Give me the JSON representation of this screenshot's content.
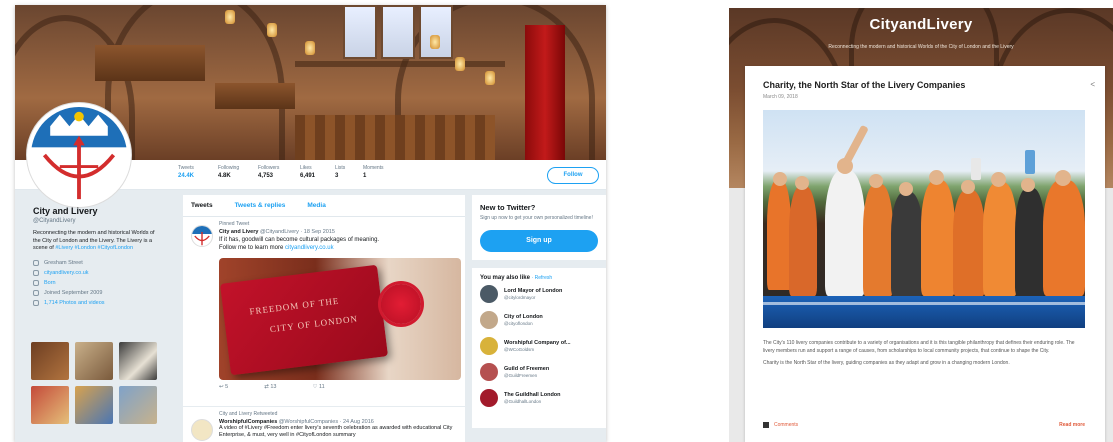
{
  "twitter": {
    "stats": [
      {
        "label": "Tweets",
        "value": "24.4K",
        "active": true
      },
      {
        "label": "Following",
        "value": "4.8K",
        "active": false
      },
      {
        "label": "Followers",
        "value": "4,753",
        "active": false
      },
      {
        "label": "Likes",
        "value": "6,491",
        "active": false
      },
      {
        "label": "Lists",
        "value": "3",
        "active": false
      },
      {
        "label": "Moments",
        "value": "1",
        "active": false
      }
    ],
    "follow_label": "Follow",
    "profile": {
      "name": "City and Livery",
      "handle": "@CityandLivery",
      "bio": "Reconnecting the modern and historical Worlds of the City of London and the Livery. The Livery is a scene of",
      "bio_link": "#Livery #London #CityofLondon",
      "location": "Gresham Street",
      "website": "cityandlivery.co.uk",
      "joined": "Joined September 2009",
      "extra": "Born",
      "photos_label": "1,714 Photos and videos"
    },
    "tabs": [
      "Tweets",
      "Tweets & replies",
      "Media"
    ],
    "pinned_label": "Pinned Tweet",
    "tweet1": {
      "name": "City and Livery",
      "handle": "@CityandLivery · 18 Sep 2015",
      "text": "If it has, goodwill can become cultural packages of meaning.",
      "text2": "Follow me to learn more",
      "link": "cityandlivery.co.uk",
      "card_line1": "FREEDOM OF THE",
      "card_line2": "CITY OF LONDON",
      "actions": [
        "5",
        "13",
        "11"
      ]
    },
    "tweet2": {
      "retweet_label": "City and Livery Retweeted",
      "name": "WorshipfulCompanies",
      "handle": "@WorshipfulCompanies · 24 Aug 2016",
      "text": "A video of #Livery #Freedom enter livery's seventh celebration as awarded with educational City Enterprise, & must, very well in #CityofLondon summary"
    },
    "new_to_twitter": {
      "title": "New to Twitter?",
      "text": "Sign up now to get your own personalized timeline!",
      "signup_label": "Sign up"
    },
    "wtf": {
      "title": "You may also like",
      "refresh": "· Refresh",
      "suggestions": [
        {
          "name": "Lord Mayor of London",
          "handle": "@citylordmayor",
          "color": "#4b5a66"
        },
        {
          "name": "City of London",
          "handle": "@cityoflondon",
          "color": "#c2a88a"
        },
        {
          "name": "Worshipful Company of...",
          "handle": "@WCoGoldsm",
          "color": "#d8b23a"
        },
        {
          "name": "Guild of Freemen",
          "handle": "@GuildFreemen",
          "color": "#b55050"
        },
        {
          "name": "The Guildhall London",
          "handle": "@GuildhallLondon",
          "color": "#a21a2b"
        }
      ]
    }
  },
  "blog": {
    "site_title": "CityandLivery",
    "tagline": "Reconnecting the modern and historical Worlds of the City of London and the Livery",
    "post_title": "Charity, the North Star of the Livery Companies",
    "post_date": "March 09, 2018",
    "share_icon": "share-icon",
    "paragraph1": "The City's 110 livery companies contribute to a variety of organisations and it is this tangible philanthropy that defines their enduring role. The livery members run and support a range of causes, from scholarships to local community projects, that continue to shape the City.",
    "paragraph2": "Charity is the North Star of the livery, guiding companies as they adapt and grow in a changing modern London.",
    "share_label": "Comments",
    "read_more": "Read more"
  }
}
